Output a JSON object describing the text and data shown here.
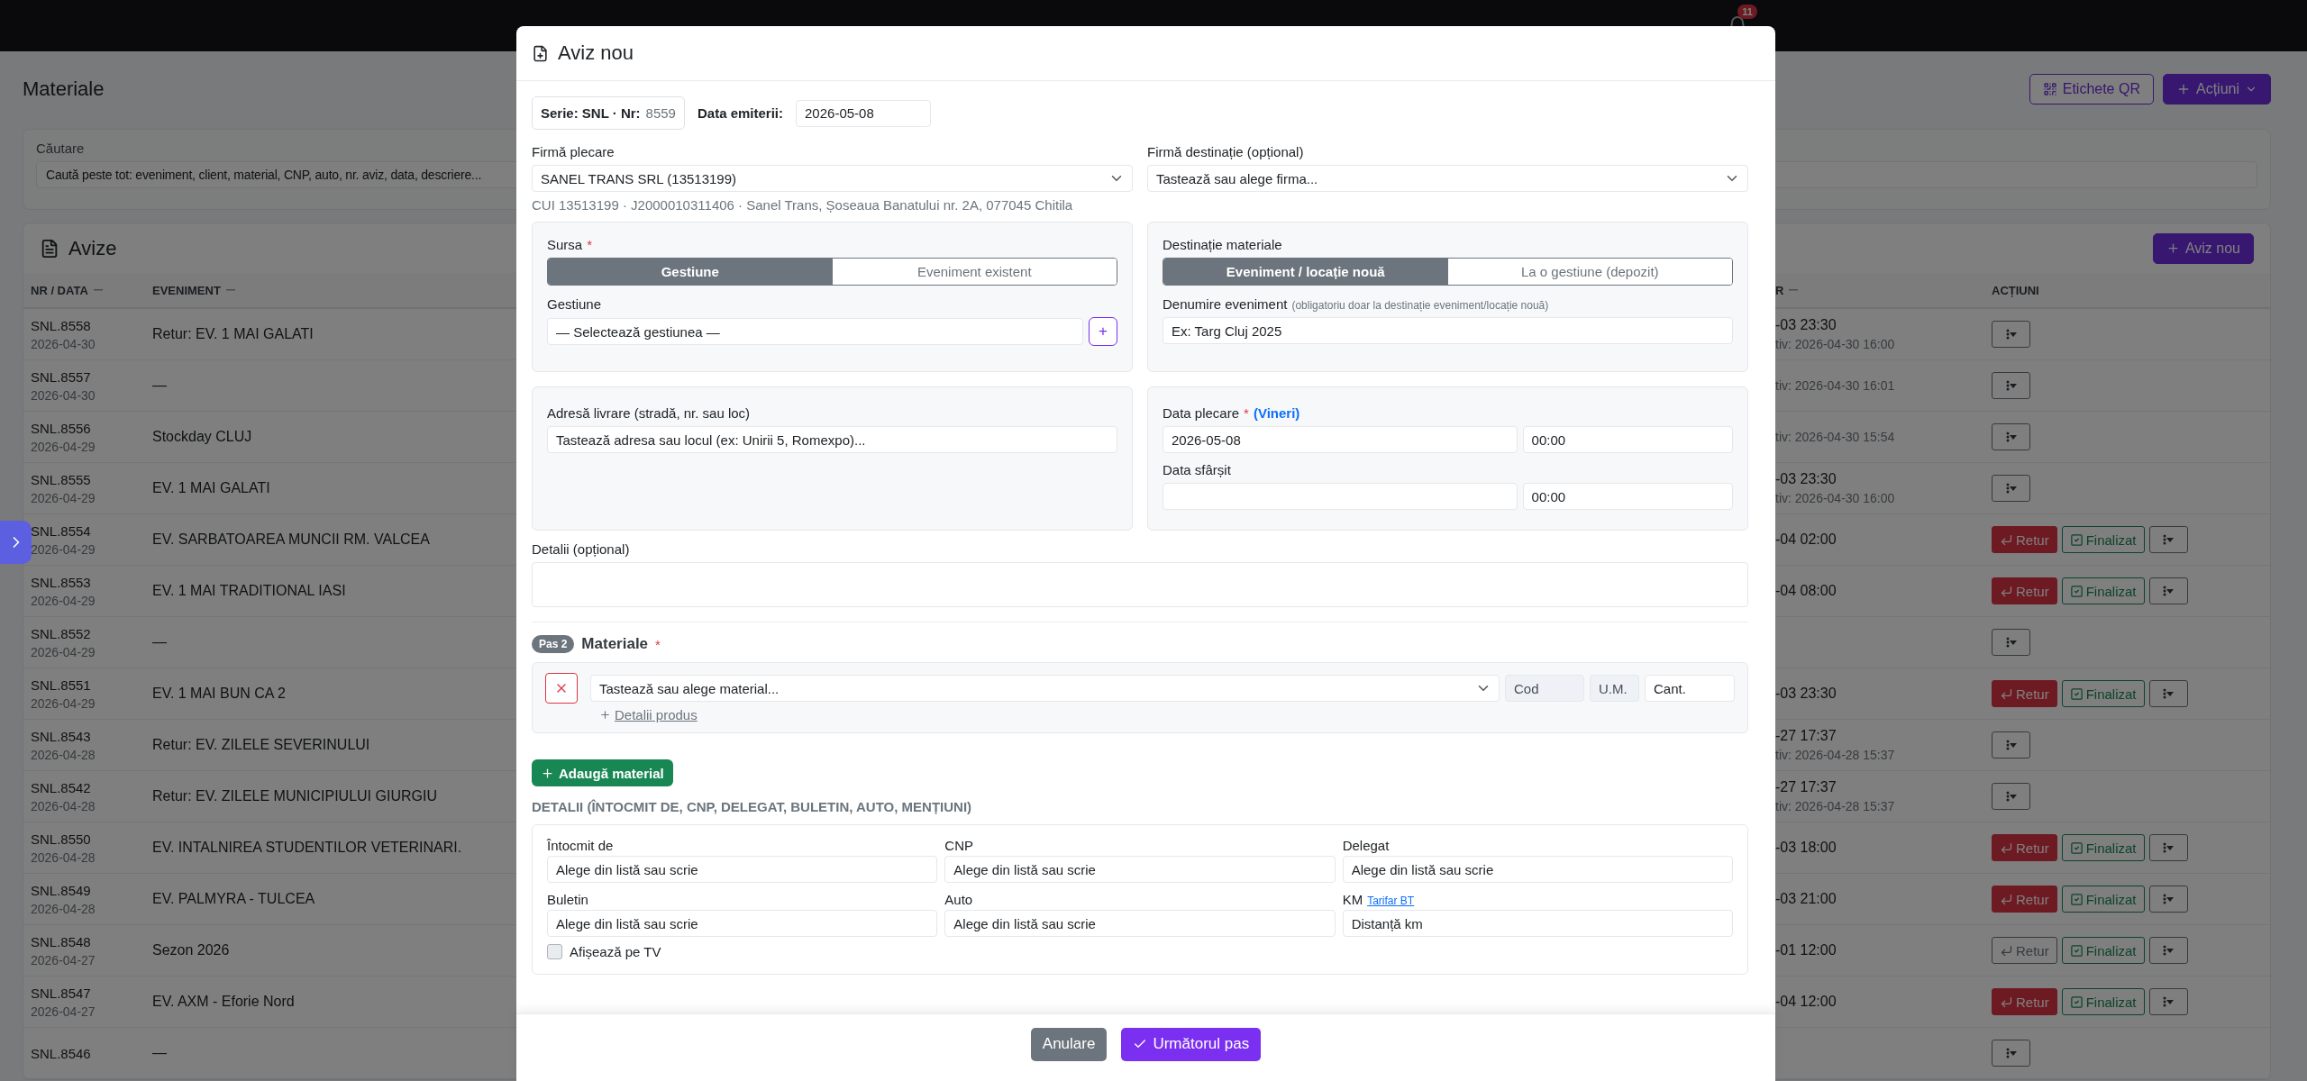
{
  "topbar": {
    "notifications": "11"
  },
  "page": {
    "title": "Materiale",
    "buttons": [
      {
        "kind": "qr",
        "label": "Etichete QR"
      },
      {
        "kind": "actions",
        "label": "Acțiuni"
      }
    ],
    "search": {
      "label": "Căutare",
      "placeholder": "Caută peste tot: eveniment, client, material, CNP, auto, nr. aviz, data, descriere..."
    },
    "avize": {
      "title": "Avize",
      "new_button": "Aviz nou",
      "columns": [
        "NR / DATA",
        "EVENIMENT",
        "R",
        "ACȚIUNI"
      ],
      "rows": [
        {
          "nr": "SNL.8558",
          "date": "2026-04-30",
          "event": "Retur: EV. 1 MAI GALATI",
          "column_3": "-03 23:30",
          "column_3_sub": "tiv: 2026-04-30 16:00",
          "actions": [
            {
              "kind": "menu"
            }
          ]
        },
        {
          "nr": "SNL.8557",
          "date": "2026-04-30",
          "event": "—",
          "column_3_sub": "tiv: 2026-04-30 16:01",
          "actions": [
            {
              "kind": "menu"
            }
          ]
        },
        {
          "nr": "SNL.8556",
          "date": "2026-04-29",
          "event": "Stockday CLUJ",
          "column_3_sub": "tiv: 2026-04-30 15:54",
          "actions": [
            {
              "kind": "menu"
            }
          ]
        },
        {
          "nr": "SNL.8555",
          "date": "2026-04-29",
          "event": "EV. 1 MAI GALATI",
          "column_3": "-03 23:30",
          "column_3_sub": "tiv: 2026-04-30 16:00",
          "actions": [
            {
              "kind": "menu"
            }
          ]
        },
        {
          "nr": "SNL.8554",
          "date": "2026-04-29",
          "event": "EV. SARBATOAREA MUNCII RM. VALCEA",
          "column_3": "-04 02:00",
          "actions": [
            {
              "kind": "retur",
              "label": "Retur",
              "active": true
            },
            {
              "kind": "finalizat",
              "label": "Finalizat"
            },
            {
              "kind": "menu"
            }
          ]
        },
        {
          "nr": "SNL.8553",
          "date": "2026-04-29",
          "event": "EV. 1 MAI TRADITIONAL IASI",
          "column_3": "-04 08:00",
          "actions": [
            {
              "kind": "retur",
              "label": "Retur",
              "active": true
            },
            {
              "kind": "finalizat",
              "label": "Finalizat"
            },
            {
              "kind": "menu"
            }
          ]
        },
        {
          "nr": "SNL.8552",
          "date": "2026-04-29",
          "event": "—",
          "actions": [
            {
              "kind": "menu"
            }
          ]
        },
        {
          "nr": "SNL.8551",
          "date": "2026-04-29",
          "event": "EV. 1 MAI BUN CA 2",
          "column_3": "-03 23:30",
          "actions": [
            {
              "kind": "retur",
              "label": "Retur",
              "active": true
            },
            {
              "kind": "finalizat",
              "label": "Finalizat"
            },
            {
              "kind": "menu"
            }
          ]
        },
        {
          "nr": "SNL.8543",
          "date": "2026-04-28",
          "event": "Retur: EV. ZILELE SEVERINULUI",
          "column_3": "-27 17:37",
          "column_3_sub": "tiv: 2026-04-28 15:37",
          "actions": [
            {
              "kind": "menu"
            }
          ]
        },
        {
          "nr": "SNL.8542",
          "date": "2026-04-28",
          "event": "Retur: EV. ZILELE MUNICIPIULUI GIURGIU",
          "column_3": "-27 17:37",
          "column_3_sub": "tiv: 2026-04-28 15:37",
          "actions": [
            {
              "kind": "menu"
            }
          ]
        },
        {
          "nr": "SNL.8550",
          "date": "2026-04-28",
          "event": "EV. INTALNIREA STUDENTILOR VETERINARI.",
          "column_3": "-03 18:00",
          "actions": [
            {
              "kind": "retur",
              "label": "Retur",
              "active": true
            },
            {
              "kind": "finalizat",
              "label": "Finalizat"
            },
            {
              "kind": "menu"
            }
          ]
        },
        {
          "nr": "SNL.8549",
          "date": "2026-04-28",
          "event": "EV. PALMYRA - TULCEA",
          "column_3": "-03 21:00",
          "actions": [
            {
              "kind": "retur",
              "label": "Retur",
              "active": true
            },
            {
              "kind": "finalizat",
              "label": "Finalizat"
            },
            {
              "kind": "menu"
            }
          ]
        },
        {
          "nr": "SNL.8548",
          "date": "2026-04-27",
          "event": "Sezon 2026",
          "column_3": "-01 12:00",
          "actions": [
            {
              "kind": "retur",
              "label": "Retur",
              "active": false
            },
            {
              "kind": "finalizat",
              "label": "Finalizat"
            },
            {
              "kind": "menu"
            }
          ]
        },
        {
          "nr": "SNL.8547",
          "date": "2026-04-27",
          "event": "EV. AXM - Eforie Nord",
          "column_3": "-04 12:00",
          "actions": [
            {
              "kind": "retur",
              "label": "Retur",
              "active": true
            },
            {
              "kind": "finalizat",
              "label": "Finalizat"
            },
            {
              "kind": "menu"
            }
          ]
        },
        {
          "nr": "SNL.8546",
          "event": "—",
          "actions": [
            {
              "kind": "menu"
            }
          ]
        }
      ]
    }
  },
  "modal": {
    "title": "Aviz nou",
    "serie_label": "Serie: SNL · Nr:",
    "serie_nr": "8559",
    "data_emiterii_label": "Data emiterii:",
    "data_emiterii": "2026-05-08",
    "firma_plecare": {
      "label": "Firmă plecare",
      "value": "SANEL TRANS SRL (13513199)",
      "info": "CUI 13513199 · J2000010311406 · Sanel Trans, Șoseaua Banatului nr. 2A, 077045 Chitila"
    },
    "firma_destinatie": {
      "label": "Firmă destinație (opțional)",
      "placeholder": "Tastează sau alege firma..."
    },
    "sursa": {
      "label": "Sursa",
      "required_mark": "*",
      "options": [
        {
          "label": "Gestiune",
          "selected": true
        },
        {
          "label": "Eveniment existent",
          "selected": false
        }
      ],
      "gestiune_label": "Gestiune",
      "gestiune_value": "— Selectează gestiunea —",
      "add_button": "+"
    },
    "destinatie": {
      "label": "Destinație materiale",
      "options": [
        {
          "label": "Eveniment / locație nouă",
          "selected": true
        },
        {
          "label": "La o gestiune (depozit)",
          "selected": false
        }
      ],
      "denumire_label": "Denumire eveniment",
      "denumire_hint": "(obligatoriu doar la destinație eveniment/locație nouă)",
      "denumire_placeholder": "Ex: Targ Cluj 2025"
    },
    "adresa": {
      "label": "Adresă livrare (stradă, nr. sau loc)",
      "placeholder": "Tastează adresa sau locul (ex: Unirii 5, Romexpo)..."
    },
    "data_plecare": {
      "label": "Data plecare",
      "required_mark": "*",
      "day": "(Vineri)",
      "date": "2026-05-08",
      "time": "00:00"
    },
    "data_sfarsit": {
      "label": "Data sfârșit",
      "time": "00:00"
    },
    "detalii": {
      "label": "Detalii (opțional)"
    },
    "materiale": {
      "step": "Pas 2",
      "title": "Materiale",
      "required_mark": "*",
      "rows": [
        {
          "placeholder": "Tastează sau alege material...",
          "cod": "Cod",
          "um": "U.M.",
          "cant_placeholder": "Cant.",
          "detalii_link": "Detalii produs"
        }
      ],
      "add_button": "Adaugă material"
    },
    "details": {
      "heading": "DETALII (ÎNTOCMIT DE, CNP, DELEGAT, BULETIN, AUTO, MENȚIUNI)",
      "fields": [
        {
          "label": "Întocmit de",
          "placeholder": "Alege din listă sau scrie"
        },
        {
          "label": "CNP",
          "placeholder": "Alege din listă sau scrie"
        },
        {
          "label": "Delegat",
          "placeholder": "Alege din listă sau scrie"
        },
        {
          "label": "Buletin",
          "placeholder": "Alege din listă sau scrie"
        },
        {
          "label": "Auto",
          "placeholder": "Alege din listă sau scrie"
        },
        {
          "label": "KM",
          "link": "Tarifar BT",
          "placeholder": "Distanță km"
        }
      ],
      "tv": {
        "label": "Afișează pe TV",
        "checked": false
      }
    },
    "footer": {
      "cancel": "Anulare",
      "next": "Următorul pas"
    }
  }
}
